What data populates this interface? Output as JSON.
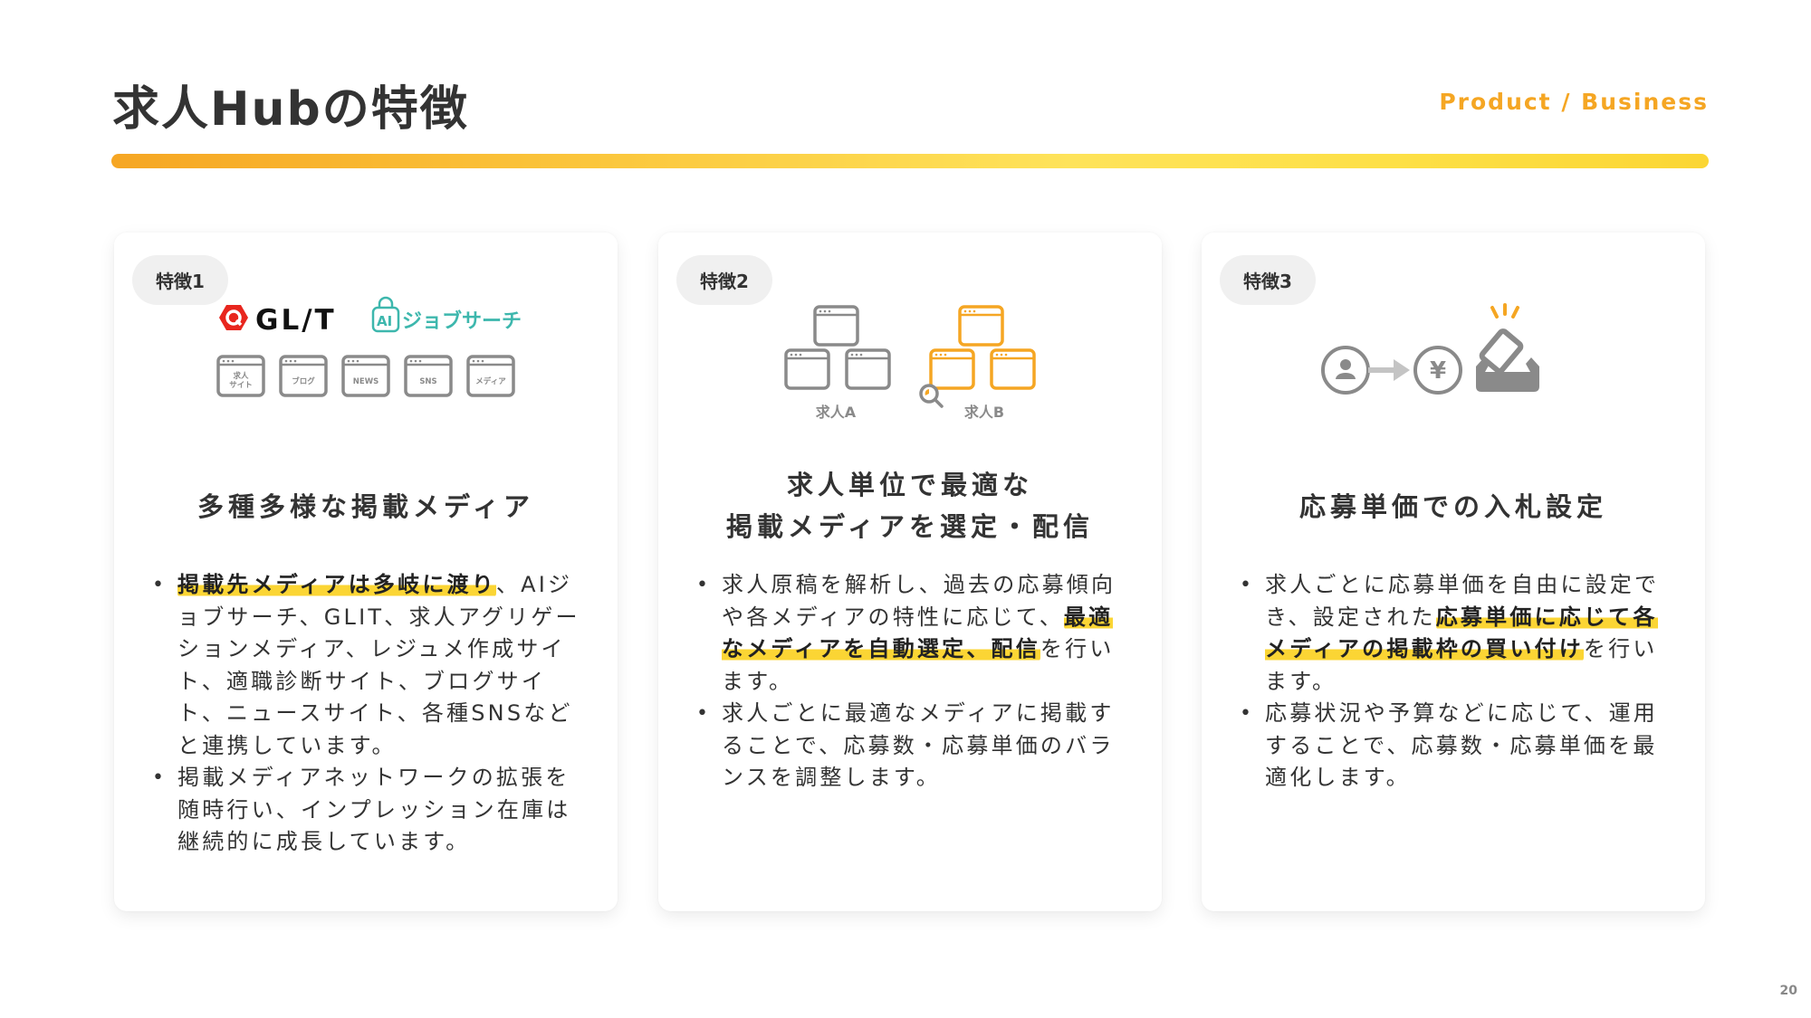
{
  "header": {
    "title": "求人Hubの特徴",
    "section_label": "Product / Business",
    "accent_color": "#F5A623"
  },
  "cards": [
    {
      "badge": "特徴1",
      "illustration": {
        "logos": [
          {
            "name": "GL/T",
            "icon": "glit-logo",
            "color": "#E8261E"
          },
          {
            "name": "ジョブサーチ",
            "prefix": "AI",
            "icon": "ai-jobsearch-logo",
            "color": "#3DB7AD"
          }
        ],
        "media_windows": [
          {
            "label_line1": "求人",
            "label_line2": "サイト"
          },
          {
            "label_line1": "ブログ",
            "label_line2": ""
          },
          {
            "label_line1": "NEWS",
            "label_line2": ""
          },
          {
            "label_line1": "SNS",
            "label_line2": ""
          },
          {
            "label_line1": "メディア",
            "label_line2": ""
          }
        ]
      },
      "title_lines": [
        "多種多様な掲載メディア"
      ],
      "bullets": [
        [
          {
            "text": "掲載先メディアは多岐に渡り",
            "highlight": true
          },
          {
            "text": "、AIジョブサーチ、GLIT、求人アグリゲーションメディア、レジュメ作成サイト、適職診断サイト、ブログサイト、ニュースサイト、各種SNSなどと連携しています。",
            "highlight": false
          }
        ],
        [
          {
            "text": "掲載メディアネットワークの拡張を随時行い、インプレッション在庫は継続的に成長しています。",
            "highlight": false
          }
        ]
      ]
    },
    {
      "badge": "特徴2",
      "illustration": {
        "groups": [
          {
            "label": "求人A",
            "color": "#8A8A8A"
          },
          {
            "label": "求人B",
            "color": "#F5A623"
          }
        ]
      },
      "title_lines": [
        "求人単位で最適な",
        "掲載メディアを選定・配信"
      ],
      "bullets": [
        [
          {
            "text": "求人原稿を解析し、過去の応募傾向や各メディアの特性に応じて、",
            "highlight": false
          },
          {
            "text": "最適なメディアを自動選定、配信",
            "highlight": true
          },
          {
            "text": "を行います。",
            "highlight": false
          }
        ],
        [
          {
            "text": "求人ごとに最適なメディアに掲載することで、応募数・応募単価のバランスを調整します。",
            "highlight": false
          }
        ]
      ]
    },
    {
      "badge": "特徴3",
      "illustration": {
        "person_icon": "user-circle-icon",
        "currency_symbol": "¥",
        "bid_icon": "ballot-box-icon"
      },
      "title_lines": [
        "応募単価での入札設定"
      ],
      "bullets": [
        [
          {
            "text": "求人ごとに応募単価を自由に設定でき、設定された",
            "highlight": false
          },
          {
            "text": "応募単価に応じて各メディアの掲載枠の買い付け",
            "highlight": true
          },
          {
            "text": "を行います。",
            "highlight": false
          }
        ],
        [
          {
            "text": "応募状況や予算などに応じて、運用することで、応募数・応募単価を最適化します。",
            "highlight": false
          }
        ]
      ]
    }
  ],
  "footer": {
    "page_number": "20"
  }
}
